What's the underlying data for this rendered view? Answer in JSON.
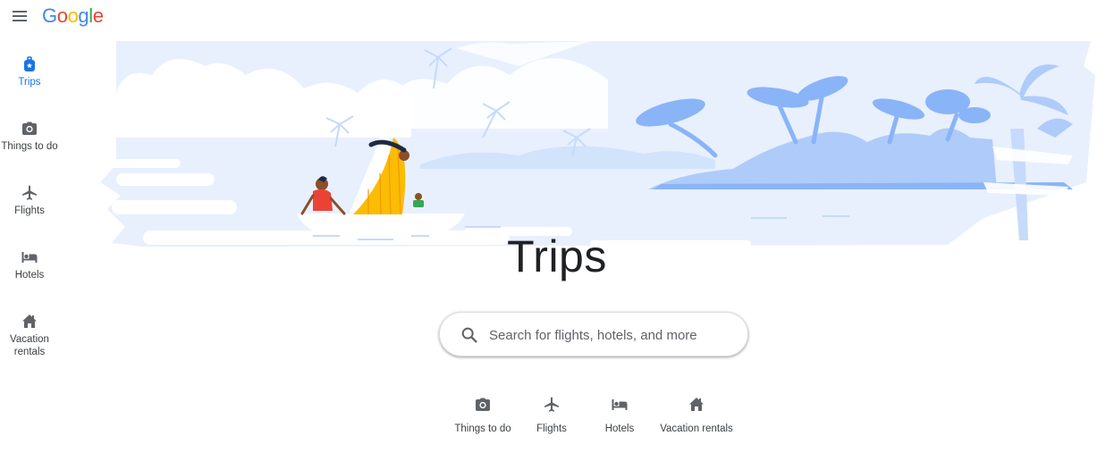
{
  "header": {
    "menu_icon": "hamburger-menu-icon",
    "logo_letters": [
      "G",
      "o",
      "o",
      "g",
      "l",
      "e"
    ],
    "logo_colors": [
      "#4285F4",
      "#EA4335",
      "#FBBC05",
      "#4285F4",
      "#34A853",
      "#EA4335"
    ]
  },
  "rail": {
    "items": [
      {
        "label": "Trips",
        "icon": "luggage-icon",
        "active": true
      },
      {
        "label": "Things to do",
        "icon": "camera-icon",
        "active": false
      },
      {
        "label": "Flights",
        "icon": "airplane-icon",
        "active": false
      },
      {
        "label": "Hotels",
        "icon": "bed-icon",
        "active": false
      },
      {
        "label": "Vacation rentals",
        "icon": "house-icon",
        "active": false
      }
    ],
    "active_color": "#1a73e8"
  },
  "main": {
    "title": "Trips",
    "search": {
      "placeholder": "Search for flights, hotels, and more",
      "value": "",
      "icon": "search-icon"
    },
    "chips": [
      {
        "label": "Things to do",
        "icon": "camera-icon"
      },
      {
        "label": "Flights",
        "icon": "airplane-icon"
      },
      {
        "label": "Hotels",
        "icon": "bed-icon"
      },
      {
        "label": "Vacation rentals",
        "icon": "house-icon"
      }
    ]
  },
  "colors": {
    "hero_sky": "#e8f0fe",
    "hero_cloud": "#ffffff",
    "hero_island": "#aecbfa",
    "hero_island_dark": "#8ab4f8",
    "sail_yellow": "#fbbc04",
    "shirt_red": "#ea4335"
  }
}
